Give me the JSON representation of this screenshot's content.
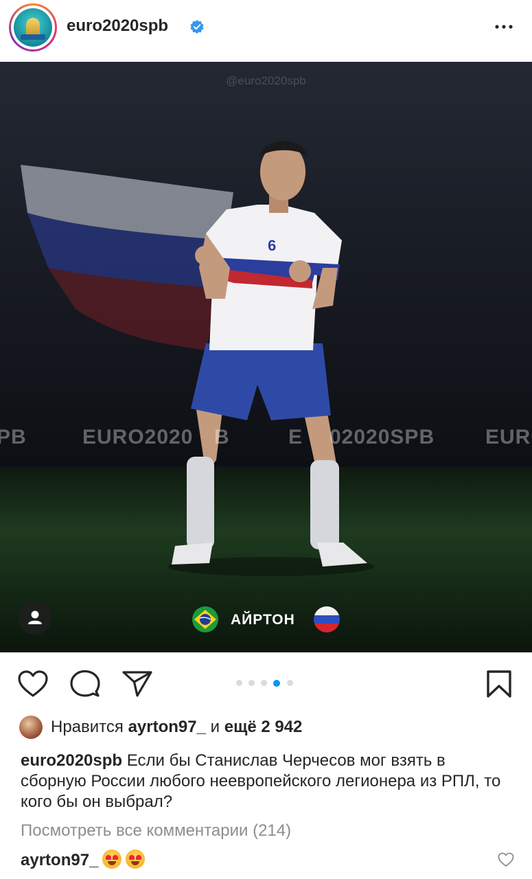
{
  "header": {
    "username": "euro2020spb",
    "verified_icon": "verified-badge-icon",
    "more_icon": "more-options-icon"
  },
  "post_image": {
    "watermark": "@euro2020spb",
    "band_texts": [
      "PB",
      "EURO2020",
      "B",
      "E",
      "02020SPB",
      "EURO"
    ],
    "player_name": "АЙРТОН",
    "left_flag": "brazil-flag",
    "right_flag": "russia-flag",
    "user_tag_icon": "user-tag-icon"
  },
  "actions": {
    "like_icon": "heart-icon",
    "comment_icon": "comment-icon",
    "share_icon": "share-icon",
    "save_icon": "bookmark-icon",
    "carousel_total": 5,
    "carousel_active": 4,
    "accent": "#0095f6"
  },
  "likes": {
    "prefix": "Нравится ",
    "user": "ayrton97_",
    "middle": " и ",
    "count": "ещё 2 942"
  },
  "caption": {
    "user": "euro2020spb",
    "text": "Если бы Станислав Черчесов мог взять в сборную России любого неевропейского легионера из РПЛ, то кого бы он выбрал?"
  },
  "view_all_comments": "Посмотреть все комментарии (214)",
  "comment": {
    "user": "ayrton97_",
    "emoji": "heart-eyes-emoji",
    "like_icon": "small-heart-icon"
  }
}
